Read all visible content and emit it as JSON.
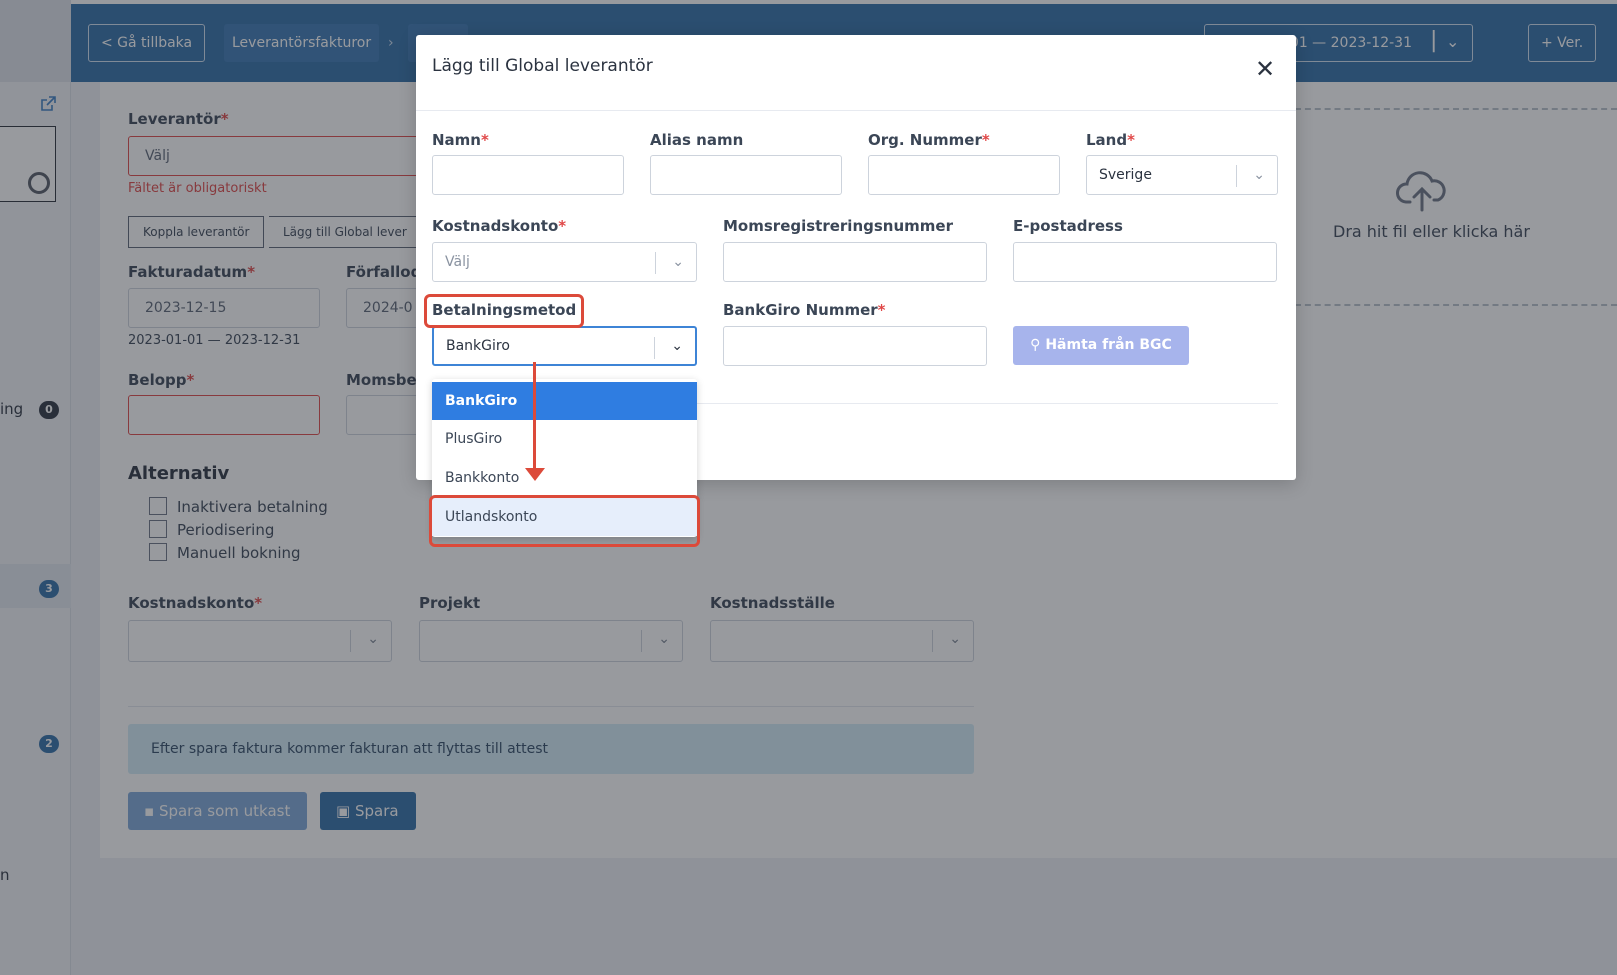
{
  "topbar": {
    "back_label": "< Gå tillbaka",
    "breadcrumb": "Leverantörsfakturor",
    "period_label": "-01 — 2023-12-31",
    "new_ver_label": "+ Ver."
  },
  "sidebar": {
    "items": [
      {
        "label": "ing",
        "badge": "0"
      },
      {
        "label": "",
        "badge": "3"
      },
      {
        "label": "",
        "badge": "2"
      },
      {
        "label": "n",
        "badge": ""
      }
    ]
  },
  "form": {
    "supplier_label": "Leverantör",
    "supplier_placeholder": "Välj",
    "supplier_error": "Fältet är obligatoriskt",
    "connect_supplier_label": "Koppla leverantör",
    "add_global_supplier_label": "Lägg till Global lever",
    "invoice_date_label": "Fakturadatum",
    "invoice_date_value": "2023-12-15",
    "invoice_date_range": "2023-01-01 — 2023-12-31",
    "due_date_label": "Förfallod",
    "due_date_value": "2024-0",
    "amount_label": "Belopp",
    "vat_label": "Momsbe",
    "options_title": "Alternativ",
    "options": [
      "Inaktivera betalning",
      "Periodisering",
      "Manuell bokning"
    ],
    "cost_account_label": "Kostnadskonto",
    "project_label": "Projekt",
    "cost_center_label": "Kostnadsställe",
    "info_text": "Efter spara faktura kommer fakturan att flyttas till attest",
    "save_draft_label": "Spara som utkast",
    "save_label": "Spara",
    "upload_text": "Dra hit fil eller klicka här",
    "required_mark": "*"
  },
  "modal": {
    "title": "Lägg till Global leverantör",
    "name_label": "Namn",
    "alias_label": "Alias namn",
    "org_label": "Org. Nummer",
    "country_label": "Land",
    "country_value": "Sverige",
    "cost_account_label": "Kostnadskonto",
    "cost_account_placeholder": "Välj",
    "vat_reg_label": "Momsregistreringsnummer",
    "email_label": "E-postadress",
    "payment_method_label": "Betalningsmetod",
    "payment_method_value": "BankGiro",
    "bankgiro_number_label": "BankGiro Nummer",
    "fetch_bgc_label": "Hämta från BGC",
    "payment_options": [
      "BankGiro",
      "PlusGiro",
      "Bankkonto",
      "Utlandskonto"
    ]
  },
  "colors": {
    "topbar": "#2f6da8",
    "accent": "#2f7de1",
    "error": "#e04848",
    "annotation": "#dc4a3a",
    "info_bg": "#d4ecf7"
  }
}
